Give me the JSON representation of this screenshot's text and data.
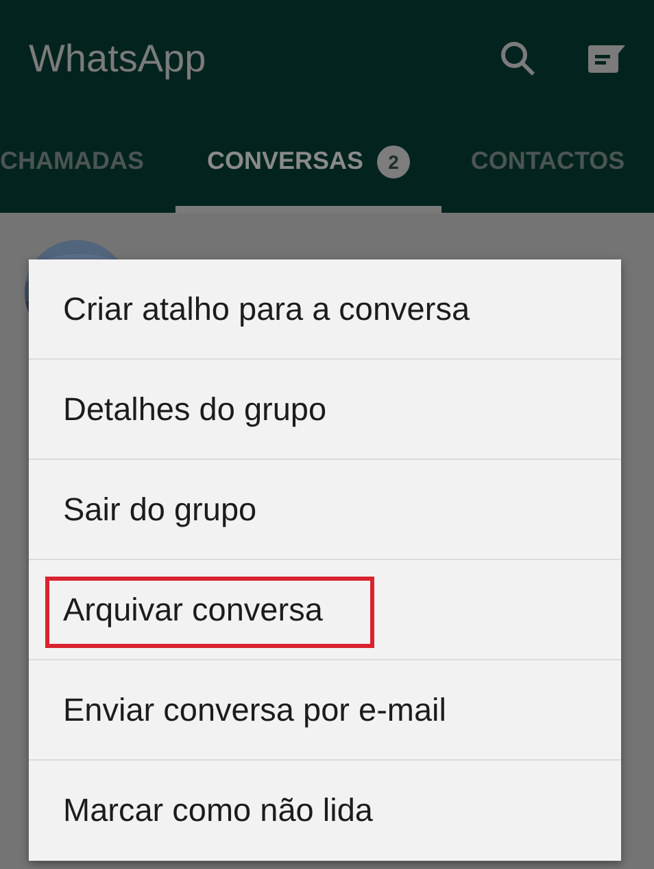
{
  "app_bar": {
    "title": "WhatsApp"
  },
  "tabs": [
    {
      "label": "CHAMADAS",
      "selected": false
    },
    {
      "label": "CONVERSAS",
      "selected": true,
      "badge": "2"
    },
    {
      "label": "CONTACTOS",
      "selected": false
    }
  ],
  "context_menu": [
    {
      "label": "Criar atalho para a conversa",
      "highlighted": false
    },
    {
      "label": "Detalhes do grupo",
      "highlighted": false
    },
    {
      "label": "Sair do grupo",
      "highlighted": false
    },
    {
      "label": "Arquivar conversa",
      "highlighted": true
    },
    {
      "label": "Enviar conversa por e-mail",
      "highlighted": false
    },
    {
      "label": "Marcar como não lida",
      "highlighted": false
    }
  ]
}
